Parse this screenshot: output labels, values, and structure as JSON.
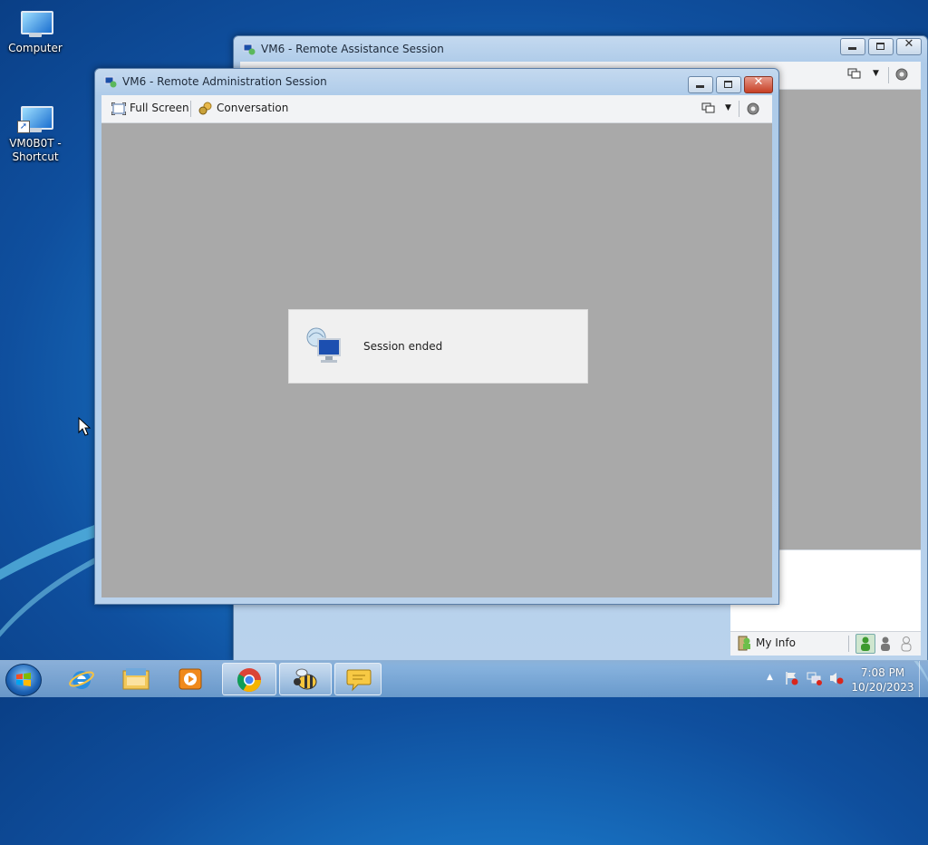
{
  "desktop": {
    "icons": [
      {
        "label": "Computer"
      },
      {
        "label": "VM0B0T -\nShortcut"
      }
    ]
  },
  "back_window": {
    "title": "VM6 - Remote Assistance Session",
    "my_info_label": "My Info"
  },
  "front_window": {
    "title": "VM6 - Remote Administration Session",
    "toolbar": {
      "full_screen": "Full Screen",
      "conversation": "Conversation"
    },
    "dialog_message": "Session ended"
  },
  "taskbar": {
    "clock_time": "7:08 PM",
    "clock_date": "10/20/2023",
    "apps": [
      "internet-explorer-icon",
      "file-explorer-icon",
      "media-player-icon",
      "chrome-icon",
      "bee-app-icon",
      "chat-app-icon"
    ]
  },
  "colors": {
    "session_background": "#a9a9a9",
    "title_bar": "#b9d2ec",
    "close_button": "#c63f24"
  }
}
